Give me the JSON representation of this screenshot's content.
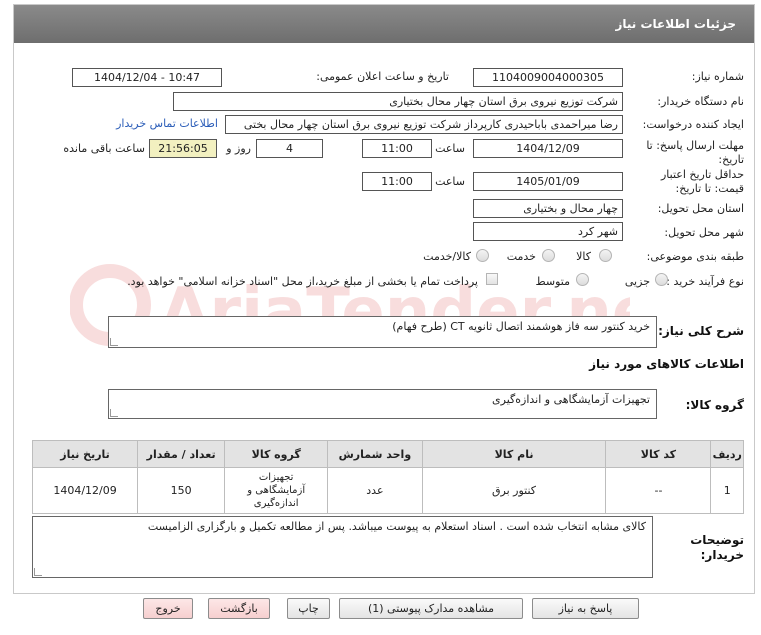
{
  "header": {
    "title": "جزئیات اطلاعات نیاز"
  },
  "fields": {
    "need_number_label": "شماره نیاز:",
    "need_number": "1104009004000305",
    "announce_label": "تاریخ و ساعت اعلان عمومی:",
    "announce_value": "1404/12/04 - 10:47",
    "buyer_org_label": "نام دستگاه خریدار:",
    "buyer_org": "شرکت توزیع نیروی برق استان چهار محال بختیاری",
    "creator_label": "ایجاد کننده درخواست:",
    "creator": "رضا میراحمدی باباحیدری کارپرداز شرکت توزیع نیروی برق استان چهار محال بختی",
    "contact_link": "اطلاعات تماس خریدار",
    "deadline_label": "مهلت ارسال پاسخ: تا تاریخ:",
    "deadline_date": "1404/12/09",
    "time_label": "ساعت",
    "deadline_time": "11:00",
    "days_value": "4",
    "days_label": "روز و",
    "remaining_time": "21:56:05",
    "remaining_label": "ساعت باقی مانده",
    "validity_label": "حداقل تاریخ اعتبار قیمت: تا تاریخ:",
    "validity_date": "1405/01/09",
    "validity_time": "11:00",
    "province_label": "استان محل تحویل:",
    "province": "چهار محال و بختیاری",
    "city_label": "شهر محل تحویل:",
    "city": "شهر کرد",
    "category_label": "طبقه بندی موضوعی:",
    "category_options": [
      "کالا",
      "خدمت",
      "کالا/خدمت"
    ],
    "purchase_type_label": "نوع فرآیند خرید :",
    "purchase_options": [
      "جزیی",
      "متوسط"
    ],
    "payment_note": "پرداخت تمام یا بخشی از مبلغ خرید،از محل \"اسناد خزانه اسلامی\" خواهد بود."
  },
  "summary": {
    "label": "شرح کلی نیاز:",
    "text": "خرید کنتور سه فاز هوشمند اتصال ثانویه CT (طرح فهام)"
  },
  "goods_info_title": "اطلاعات کالاهای مورد نیاز",
  "goods_group": {
    "label": "گروه کالا:",
    "value": "تجهیزات آزمایشگاهی و اندازه‌گیری"
  },
  "table": {
    "headers": [
      "ردیف",
      "کد کالا",
      "نام کالا",
      "واحد شمارش",
      "گروه کالا",
      "تعداد / مقدار",
      "تاریخ نیاز"
    ],
    "rows": [
      {
        "row": "1",
        "code": "--",
        "name": "کنتور برق",
        "unit": "عدد",
        "group": "تجهیزات آزمایشگاهی و اندازه‌گیری",
        "qty": "150",
        "date": "1404/12/09"
      }
    ]
  },
  "buyer_notes": {
    "label": "توضیحات خریدار:",
    "text": "کالای مشابه انتخاب شده است . اسناد استعلام به پیوست میباشد. پس از مطالعه تکمیل و بارگزاری الزامیست"
  },
  "buttons": {
    "reply": "پاسخ به نیاز",
    "view_docs": "مشاهده مدارک پیوستی (1)",
    "print": "چاپ",
    "back": "بازگشت",
    "exit": "خروج"
  },
  "watermark_text": "AriaTender.neT"
}
